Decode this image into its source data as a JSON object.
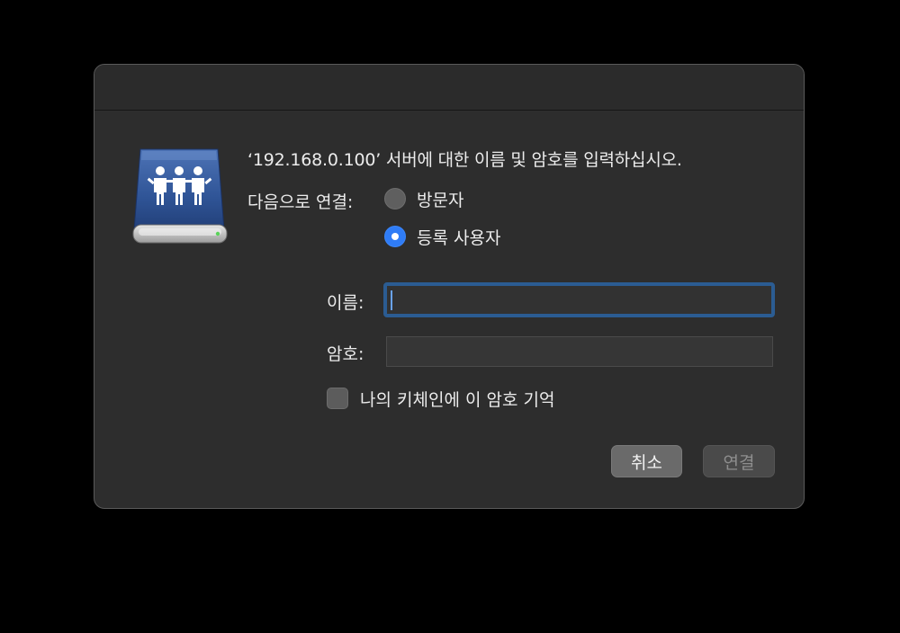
{
  "dialog": {
    "message": "‘192.168.0.100’ 서버에 대한 이름 및 암호를 입력하십시오.",
    "connect_as_label": "다음으로 연결:",
    "connect_as_options": [
      {
        "label": "방문자",
        "selected": false
      },
      {
        "label": "등록 사용자",
        "selected": true
      }
    ],
    "name_label": "이름:",
    "name_value": "",
    "password_label": "암호:",
    "password_value": "",
    "remember_label": "나의 키체인에 이 암호 기억",
    "remember_checked": false,
    "cancel_label": "취소",
    "connect_label": "연결",
    "connect_enabled": false
  },
  "icons": {
    "server": "shared-server-icon"
  },
  "colors": {
    "accent": "#2f7cf6",
    "focus_ring": "#2b5c92",
    "dialog_bg": "#2d2d2d",
    "screen_bg": "#000000"
  }
}
